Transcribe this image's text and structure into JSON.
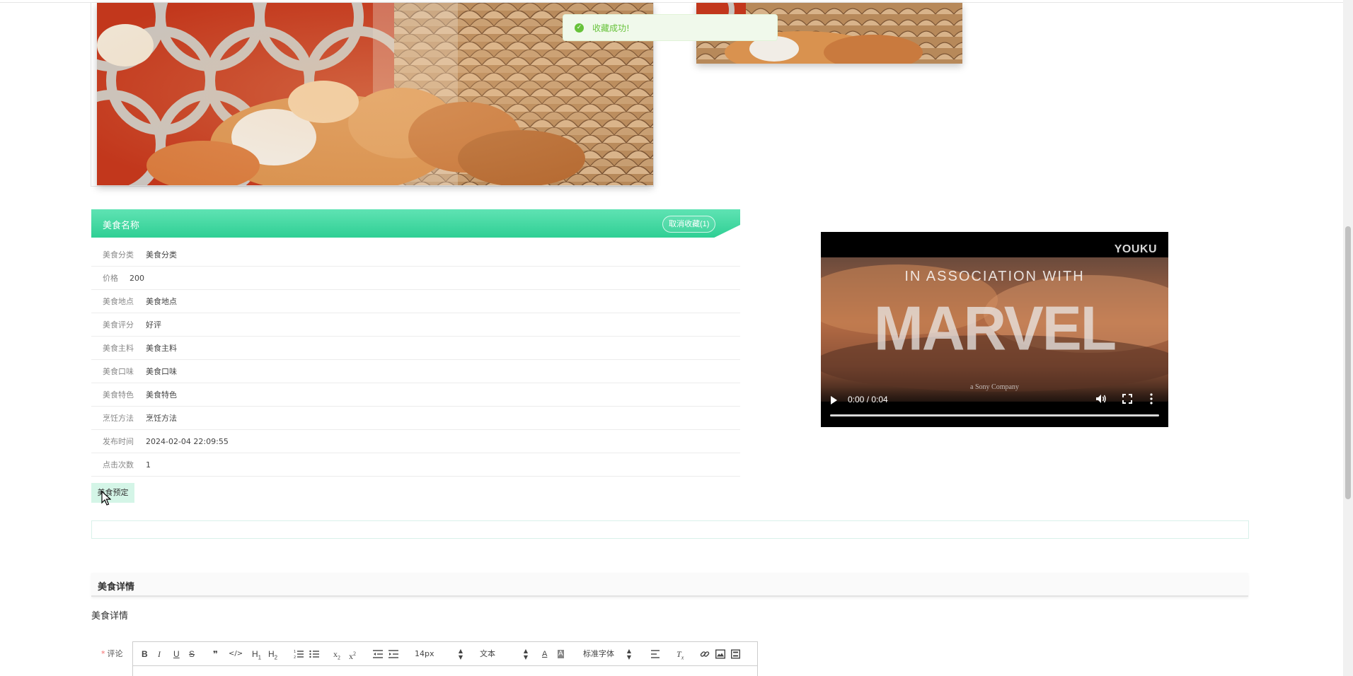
{
  "toast": {
    "message": "收藏成功!",
    "icon": "check-circle-icon"
  },
  "food": {
    "header_title": "美食名称",
    "favorite_button": "取消收藏(1)",
    "fields": [
      {
        "label": "美食分类",
        "value": "美食分类"
      },
      {
        "label": "价格",
        "value": "200"
      },
      {
        "label": "美食地点",
        "value": "美食地点"
      },
      {
        "label": "美食评分",
        "value": "好评"
      },
      {
        "label": "美食主料",
        "value": "美食主料"
      },
      {
        "label": "美食口味",
        "value": "美食口味"
      },
      {
        "label": "美食特色",
        "value": "美食特色"
      },
      {
        "label": "烹饪方法",
        "value": "烹饪方法"
      },
      {
        "label": "发布时间",
        "value": "2024-02-04 22:09:55"
      },
      {
        "label": "点击次数",
        "value": "1"
      }
    ],
    "book_button": "美食预定"
  },
  "video": {
    "watermark": "YOUKU",
    "overlay_line1": "IN ASSOCIATION WITH",
    "overlay_logo": "MARVEL",
    "overlay_line2": "a Sony Company",
    "time": "0:00 / 0:04"
  },
  "details": {
    "section_title": "美食详情",
    "content": "美食详情"
  },
  "comment": {
    "label": "评论",
    "required_mark": "*",
    "toolbar": {
      "font_size": "14px",
      "paragraph": "文本",
      "font_family": "标准字体",
      "subscript_base": "x",
      "subscript_mark": "2",
      "superscript_mark": "2",
      "h1": "H",
      "h1_mark": "1",
      "h2": "H",
      "h2_mark": "2"
    }
  },
  "colors": {
    "accent": "#2fcf94",
    "toast_bg": "#f0f9eb",
    "toast_text": "#67c23a",
    "book_button_bg": "#d4f5e7"
  }
}
